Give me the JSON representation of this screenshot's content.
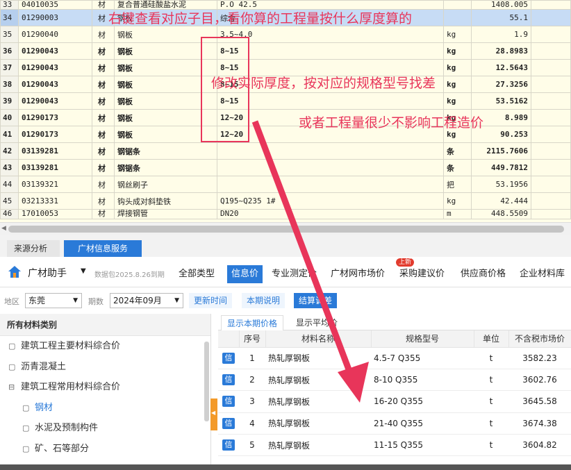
{
  "upper_table": {
    "rows": [
      {
        "num": "33",
        "code": "04010035",
        "type": "材",
        "name": "复合普通硅酸盐水泥",
        "spec": "P.O 42.5",
        "unit": "",
        "qty": "1408.005",
        "bold": false
      },
      {
        "num": "34",
        "code": "01290003",
        "type": "材",
        "name": "钢板",
        "spec": "综合",
        "unit": "",
        "qty": "55.1",
        "bold": false,
        "selected": true
      },
      {
        "num": "35",
        "code": "01290040",
        "type": "材",
        "name": "钢板",
        "spec": "3.5~4.0",
        "unit": "kg",
        "qty": "1.9",
        "bold": false
      },
      {
        "num": "36",
        "code": "01290043",
        "type": "材",
        "name": "钢板",
        "spec": "8~15",
        "unit": "kg",
        "qty": "28.8983",
        "bold": true
      },
      {
        "num": "37",
        "code": "01290043",
        "type": "材",
        "name": "钢板",
        "spec": "8~15",
        "unit": "kg",
        "qty": "12.5643",
        "bold": true
      },
      {
        "num": "38",
        "code": "01290043",
        "type": "材",
        "name": "钢板",
        "spec": "8~15",
        "unit": "kg",
        "qty": "27.3256",
        "bold": true
      },
      {
        "num": "39",
        "code": "01290043",
        "type": "材",
        "name": "钢板",
        "spec": "8~15",
        "unit": "kg",
        "qty": "53.5162",
        "bold": true
      },
      {
        "num": "40",
        "code": "01290173",
        "type": "材",
        "name": "钢板",
        "spec": "12~20",
        "unit": "kg",
        "qty": "8.989",
        "bold": true
      },
      {
        "num": "41",
        "code": "01290173",
        "type": "材",
        "name": "钢板",
        "spec": "12~20",
        "unit": "kg",
        "qty": "90.253",
        "bold": true
      },
      {
        "num": "42",
        "code": "03139281",
        "type": "材",
        "name": "钢锯条",
        "spec": "",
        "unit": "条",
        "qty": "2115.7606",
        "bold": true
      },
      {
        "num": "43",
        "code": "03139281",
        "type": "材",
        "name": "钢锯条",
        "spec": "",
        "unit": "条",
        "qty": "449.7812",
        "bold": true
      },
      {
        "num": "44",
        "code": "03139321",
        "type": "材",
        "name": "钢丝刷子",
        "spec": "",
        "unit": "把",
        "qty": "53.1956",
        "bold": false
      },
      {
        "num": "45",
        "code": "03213331",
        "type": "材",
        "name": "钩头成对斜垫铁",
        "spec": "Q195~Q235 1#",
        "unit": "kg",
        "qty": "42.444",
        "bold": false
      },
      {
        "num": "46",
        "code": "17010053",
        "type": "材",
        "name": "焊接钢管",
        "spec": "DN20",
        "unit": "m",
        "qty": "448.5509",
        "bold": false
      }
    ]
  },
  "lower_tabs": {
    "source": "来源分析",
    "gc_info": "广材信息服务"
  },
  "toolbar": {
    "brand": "广材助手",
    "package": "数据包2025.8.26到期",
    "categories": [
      "全部类型",
      "信息价",
      "专业测定价",
      "广材网市场价",
      "采购建议价",
      "供应商价格",
      "企业材料库"
    ],
    "badge": "上新"
  },
  "filters": {
    "region_label": "地区",
    "region": "东莞",
    "period_label": "期数",
    "period": "2024年09月",
    "update_time": "更新时间",
    "period_note": "本期说明",
    "settle": "结算调差"
  },
  "sidebar": {
    "header": "所有材料类别",
    "items": [
      {
        "icon": "doc",
        "label": "建筑工程主要材料综合价"
      },
      {
        "icon": "doc",
        "label": "沥青混凝土"
      },
      {
        "icon": "minus",
        "label": "建筑工程常用材料综合价"
      },
      {
        "icon": "doc",
        "label": "钢材",
        "selected": true
      },
      {
        "icon": "doc",
        "label": "水泥及预制构件"
      },
      {
        "icon": "doc",
        "label": "矿、石等部分"
      }
    ]
  },
  "price_tabs": {
    "current": "显示本期价格",
    "average": "显示平均价"
  },
  "price_table": {
    "headers": [
      "",
      "序号",
      "材料名称",
      "规格型号",
      "单位",
      "不含税市场价"
    ],
    "tag": "信",
    "rows": [
      {
        "idx": "1",
        "name": "热轧厚钢板",
        "spec": "4.5-7  Q355",
        "unit": "t",
        "price": "3582.23"
      },
      {
        "idx": "2",
        "name": "热轧厚钢板",
        "spec": "8-10  Q355",
        "unit": "t",
        "price": "3602.76"
      },
      {
        "idx": "3",
        "name": "热轧厚钢板",
        "spec": "16-20  Q355",
        "unit": "t",
        "price": "3645.58"
      },
      {
        "idx": "4",
        "name": "热轧厚钢板",
        "spec": "21-40  Q355",
        "unit": "t",
        "price": "3674.38"
      },
      {
        "idx": "5",
        "name": "热轧厚钢板",
        "spec": "11-15  Q355",
        "unit": "t",
        "price": "3604.82"
      }
    ]
  },
  "annotations": {
    "note1": "右键查看对应子目，看你算的工程量按什么厚度算的",
    "note2": "修改实际厚度，按对应的规格型号找差",
    "note3": "或者工程量很少不影响工程造价"
  },
  "colors": {
    "accent": "#2a7ad8",
    "annotation": "#e8355a",
    "orange": "#f39a2a"
  }
}
